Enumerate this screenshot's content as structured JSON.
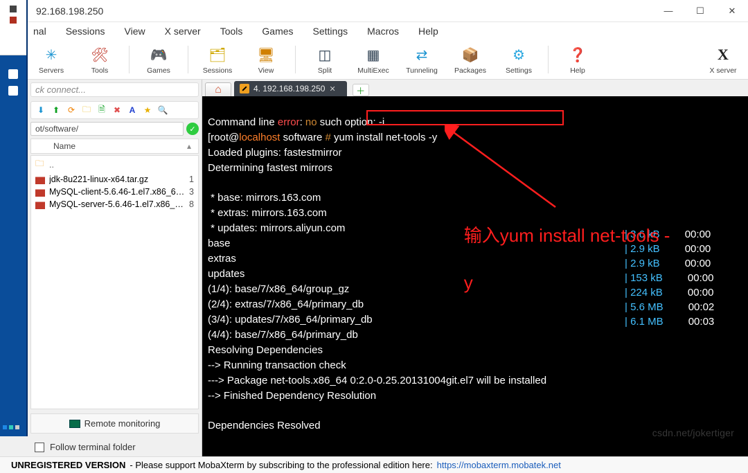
{
  "window": {
    "title_ip": "92.168.198.250"
  },
  "menu": [
    "nal",
    "Sessions",
    "View",
    "X server",
    "Tools",
    "Games",
    "Settings",
    "Macros",
    "Help"
  ],
  "toolbar": [
    {
      "label": "Servers",
      "name": "servers",
      "glyph": "✳",
      "color": "#1c94d1"
    },
    {
      "label": "Tools",
      "name": "tools",
      "glyph": "🛠",
      "color": "#c0392b"
    },
    {
      "label": "Games",
      "name": "games",
      "glyph": "🎮",
      "color": "#7da318"
    },
    {
      "label": "Sessions",
      "name": "sessions",
      "glyph": "🗂",
      "color": "#d0a800"
    },
    {
      "label": "View",
      "name": "view",
      "glyph": "🖥",
      "color": "#d08000"
    },
    {
      "label": "Split",
      "name": "split",
      "glyph": "◫",
      "color": "#2c3e50"
    },
    {
      "label": "MultiExec",
      "name": "multiexec",
      "glyph": "▦",
      "color": "#2c3e50"
    },
    {
      "label": "Tunneling",
      "name": "tunneling",
      "glyph": "⇄",
      "color": "#1c94d1"
    },
    {
      "label": "Packages",
      "name": "packages",
      "glyph": "📦",
      "color": "#c37e24"
    },
    {
      "label": "Settings",
      "name": "settings",
      "glyph": "⚙",
      "color": "#2aa7e0"
    },
    {
      "label": "Help",
      "name": "help",
      "glyph": "❓",
      "color": "#1c94d1"
    }
  ],
  "toolbar_right": {
    "label": "X server",
    "name": "xserver",
    "glyph": "X",
    "color": "#222"
  },
  "sidebar": {
    "connect_placeholder": "ck connect...",
    "path": "ot/software/",
    "header": {
      "col1": "Name",
      "col2": ""
    },
    "files": [
      {
        "name": "..",
        "icon": "up"
      },
      {
        "name": "jdk-8u221-linux-x64.tar.gz",
        "icon": "archive",
        "extra": "1"
      },
      {
        "name": "MySQL-client-5.6.46-1.el7.x86_64...",
        "icon": "archive",
        "extra": "3"
      },
      {
        "name": "MySQL-server-5.6.46-1.el7.x86_6...",
        "icon": "archive",
        "extra": "8"
      }
    ],
    "remote_monitoring": "Remote monitoring",
    "follow_terminal": "Follow terminal folder"
  },
  "tabs": {
    "home_glyph": "⌂",
    "active": "4. 192.168.198.250"
  },
  "terminal": {
    "l1a": "Command line ",
    "l1_err": "error",
    "l1b": ": ",
    "l1_no": "no",
    "l1c": " such option: -i",
    "l2a": "[root@",
    "l2_host": "localhost",
    "l2b": " software",
    "l2c": "#",
    "l2_cmd": " yum install net-tools -y",
    "l3": "Loaded plugins: fastestmirror",
    "l4": "Determining fastest mirrors",
    "l5": "",
    "l6": " * base: mirrors.163.com",
    "l7": " * extras: mirrors.163.com",
    "l8": " * updates: mirrors.aliyun.com",
    "r1": "base",
    "r1s": "| 3.6 kB",
    "r1t": "00:00",
    "r2": "extras",
    "r2s": "| 2.9 kB",
    "r2t": "00:00",
    "r3": "updates",
    "r3s": "| 2.9 kB",
    "r3t": "00:00",
    "l9": "(1/4): base/7/x86_64/group_gz",
    "r4s": "| 153 kB",
    "r4t": "00:00",
    "l10": "(2/4): extras/7/x86_64/primary_db",
    "r5s": "| 224 kB",
    "r5t": "00:00",
    "l11": "(3/4): updates/7/x86_64/primary_db",
    "r6s": "| 5.6 MB",
    "r6t": "00:02",
    "l12": "(4/4): base/7/x86_64/primary_db",
    "r7s": "| 6.1 MB",
    "r7t": "00:03",
    "l13": "Resolving Dependencies",
    "l14": "--> Running transaction check",
    "l15": "---> Package net-tools.x86_64 0:2.0-0.25.20131004git.el7 will be installed",
    "l16": "--> Finished Dependency Resolution",
    "l17": "",
    "l18": "Dependencies Resolved"
  },
  "annotation": {
    "text_line1": "输入yum install net-tools -",
    "text_line2": "y"
  },
  "watermark": "csdn.net/jokertiger",
  "footer": {
    "unreg": "UNREGISTERED VERSION",
    "msg": "  -  Please support MobaXterm by subscribing to the professional edition here:  ",
    "url": "https://mobaxterm.mobatek.net"
  }
}
